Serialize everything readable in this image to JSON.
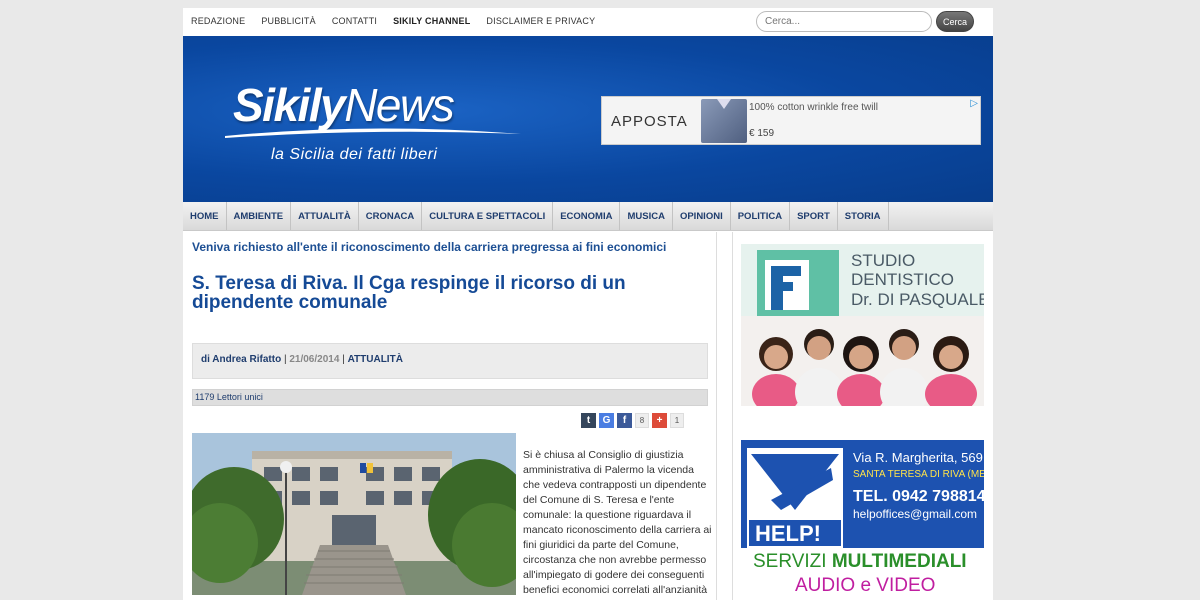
{
  "topbar": {
    "links": [
      "REDAZIONE",
      "PUBBLICITÀ",
      "CONTATTI",
      "SIKILY CHANNEL",
      "DISCLAIMER E PRIVACY"
    ],
    "search_placeholder": "Cerca...",
    "search_button": "Cerca"
  },
  "header": {
    "logo_main": "Sikily",
    "logo_news": "News",
    "tagline": "la Sicilia dei fatti liberi"
  },
  "ad": {
    "brand": "APPOSTA",
    "text": "100% cotton wrinkle free twill",
    "price": "€ 159",
    "choice": "▷"
  },
  "nav": [
    "HOME",
    "AMBIENTE",
    "ATTUALITÀ",
    "CRONACA",
    "CULTURA E SPETTACOLI",
    "ECONOMIA",
    "MUSICA",
    "OPINIONI",
    "POLITICA",
    "SPORT",
    "STORIA"
  ],
  "article": {
    "kicker": "Veniva richiesto all'ente il riconoscimento della carriera pregressa ai fini economici",
    "title": "S. Teresa di Riva. Il Cga respinge il ricorso di un dipendente comunale",
    "author": "di Andrea Rifatto",
    "date": "21/06/2014",
    "category": "ATTUALITÀ",
    "readers": "1179 Lettori unici",
    "share": {
      "t": "t",
      "g": "G",
      "f": "f",
      "f_count": "8",
      "plus": "+",
      "plus_count": "1"
    },
    "body": "Si è chiusa al Consiglio di giustizia amministrativa di Palermo la vicenda che vedeva contrapposti un dipendente del Comune di S. Teresa e l'ente comunale: la questione riguardava il mancato riconoscimento della carriera ai fini giuridici da parte del Comune, circostanza che non avrebbe permesso all'impiegato di godere dei conseguenti benefici economici correlati all'anzianità di"
  },
  "sidebar": {
    "studio_line1": "STUDIO",
    "studio_line2": "DENTISTICO",
    "studio_line3": "Dr. DI PASQUALE",
    "help_address1": "Via R. Margherita, 569",
    "help_address2": "SANTA TERESA DI RIVA (ME)",
    "help_tel": "TEL. 0942 798814",
    "help_email": "helpoffices@gmail.com",
    "help_logo": "HELP!",
    "help_services_a": "SERVIZI ",
    "help_services_b": "MULTIMEDIALI",
    "help_av": "AUDIO e VIDEO"
  }
}
